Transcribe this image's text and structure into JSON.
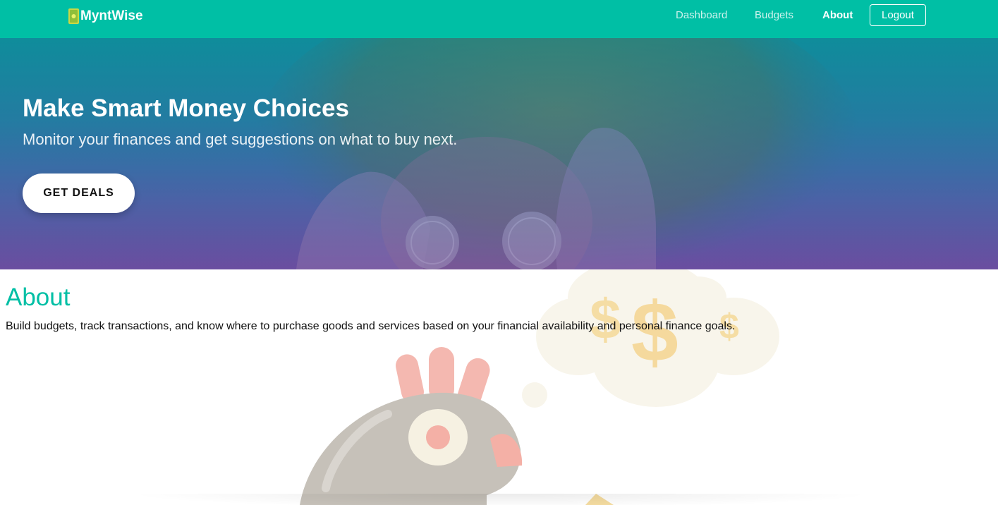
{
  "brand": {
    "name": "MyntWise",
    "icon": "money-icon"
  },
  "nav": {
    "items": [
      {
        "label": "Dashboard",
        "active": false
      },
      {
        "label": "Budgets",
        "active": false
      },
      {
        "label": "About",
        "active": true
      }
    ],
    "logout_label": "Logout"
  },
  "hero": {
    "title": "Make Smart Money Choices",
    "subtitle": "Monitor your finances and get suggestions on what to buy next.",
    "cta_label": "GET DEALS"
  },
  "about": {
    "title": "About",
    "text": "Build budgets, track transactions, and know where to purchase goods and services based on your financial availability and personal finance goals."
  },
  "colors": {
    "primary": "#00bfa5",
    "hero_gradient_top": "#0f8a9c",
    "hero_gradient_bottom": "#6a4ea1"
  }
}
